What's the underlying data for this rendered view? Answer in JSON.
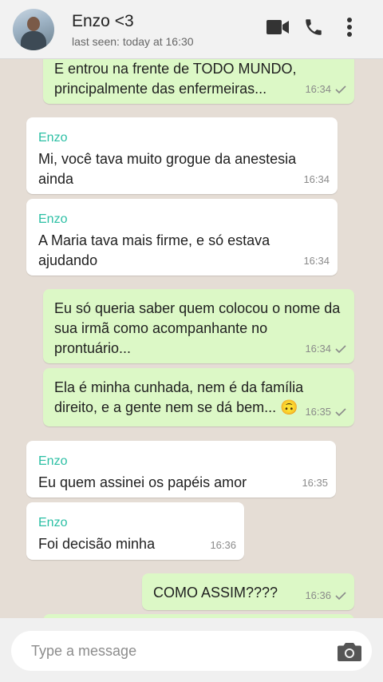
{
  "header": {
    "contact_name": "Enzo <3",
    "last_seen": "last seen: today at 16:30"
  },
  "messages": [
    {
      "direction": "out",
      "sender": "",
      "text": "E entrou na frente de TODO MUNDO,\nprincipalmente das enfermeiras...",
      "time": "16:34",
      "read": true
    },
    {
      "direction": "in",
      "sender": "Enzo",
      "text": "Mi, você tava muito grogue da anestesia\nainda",
      "time": "16:34"
    },
    {
      "direction": "in",
      "sender": "Enzo",
      "text": "A Maria tava mais firme, e só estava\najudando",
      "time": "16:34"
    },
    {
      "direction": "out",
      "sender": "",
      "text": "Eu só queria saber quem colocou o nome da\nsua irmã como acompanhante no\nprontuário...",
      "time": "16:34",
      "read": true
    },
    {
      "direction": "out",
      "sender": "",
      "text": "Ela é minha cunhada, nem é da família\ndireito, e a gente nem se dá bem... 🙃",
      "time": "16:35",
      "read": true
    },
    {
      "direction": "in",
      "sender": "Enzo",
      "text": "Eu quem assinei os papéis amor",
      "time": "16:35"
    },
    {
      "direction": "in",
      "sender": "Enzo",
      "text": "Foi decisão minha",
      "time": "16:36"
    },
    {
      "direction": "out",
      "sender": "",
      "text": "COMO ASSIM????",
      "time": "16:36",
      "read": true
    }
  ],
  "composer": {
    "placeholder": "Type a message"
  },
  "colors": {
    "incoming_bubble": "#ffffff",
    "outgoing_bubble": "#dcf8c6",
    "sender_name": "#2bbfa4",
    "chat_background": "#e5ddd5"
  }
}
